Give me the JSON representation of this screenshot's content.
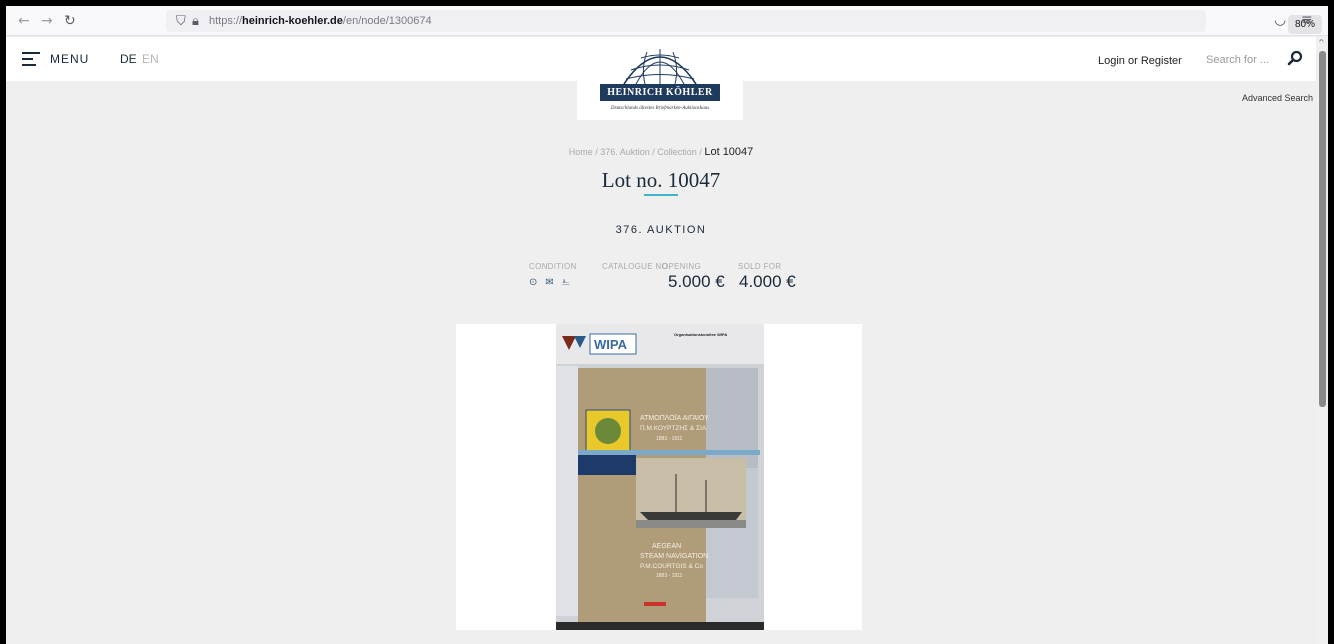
{
  "browser": {
    "url_prefix": "https://",
    "url_domain": "heinrich-koehler.de",
    "url_path": "/en/node/1300674",
    "zoom": "80%"
  },
  "header": {
    "menu_label": "MENU",
    "lang_de": "DE",
    "lang_en": "EN",
    "login_label": "Login",
    "or_label": "or",
    "register_label": "Register",
    "search_placeholder": "Search for ...",
    "advanced_search": "Advanced Search"
  },
  "logo": {
    "name": "HEINRICH KÖHLER",
    "tagline": "Deutschlands ältestes Briefmarken-Auktionshaus"
  },
  "breadcrumb": {
    "home": "Home",
    "auction": "376. Auktion",
    "collection": "Collection",
    "current": "Lot 10047",
    "separator": " / "
  },
  "lot": {
    "title": "Lot no. 10047",
    "auction": "376. AUKTION",
    "condition_label": "CONDITION",
    "catalogue_label": "CATALOGUE NO.",
    "opening_label": "OPENING",
    "sold_label": "SOLD FOR",
    "opening_price": "5.000 €",
    "sold_price": "4.000 €"
  },
  "image": {
    "sticker_org": "Organisationskomitee WIPA",
    "sticker_logo": "WIPA",
    "book_title_gr": "ΑΤΜΟΠΛΟΪΑ ΑΙΓΑΙΟΥ",
    "book_sub_gr": "Π.Μ.ΚΟΥΡΤΖΗΣ & ΣΙΑ",
    "book_years_gr": "1883 - 1911",
    "book_title_en_1": "AEGEAN",
    "book_title_en_2": "STEAM NAVIGATION",
    "book_sub_en": "P.M.COURTGIS & Co",
    "book_years_en": "1883 - 1911"
  },
  "colors": {
    "navy": "#1e3a5f",
    "accent": "#3fb5c8",
    "page_bg": "#efefef"
  }
}
